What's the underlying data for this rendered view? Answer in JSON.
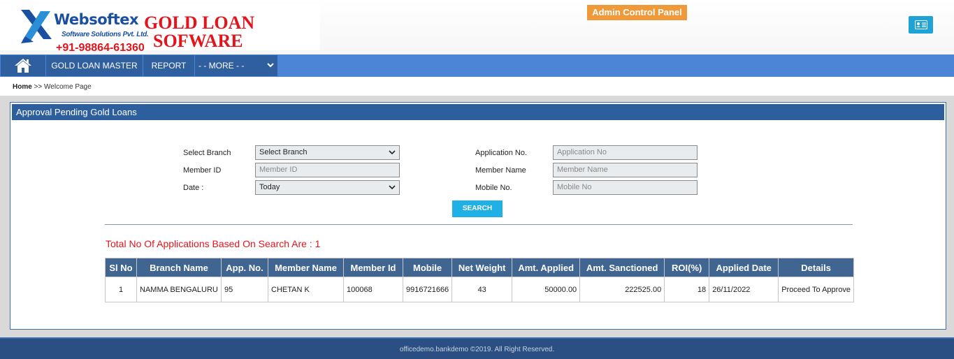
{
  "brand": {
    "name": "Websoftex",
    "subtitle": "Software Solutions Pvt. Ltd.",
    "phone": "+91-98864-61360",
    "product_line1": "GOLD LOAN",
    "product_line2": "SOFWARE",
    "logo_color": "#1b4fa0",
    "accent_color": "#e3141c"
  },
  "header": {
    "admin_panel_label": "Admin Control Panel",
    "profile_icon": "id-card-icon"
  },
  "nav": {
    "home_icon": "home-icon",
    "items": [
      "GOLD LOAN MASTER",
      "REPORT"
    ],
    "more_label": "- - MORE - -"
  },
  "breadcrumb": {
    "home": "Home",
    "separator": ">>",
    "current": "Welcome Page"
  },
  "panel": {
    "title": "Approval Pending Gold Loans"
  },
  "form": {
    "branch_label": "Select Branch",
    "branch_value": "Select Branch",
    "member_id_label": "Member ID",
    "member_id_placeholder": "Member ID",
    "date_label": "Date :",
    "date_value": "Today",
    "app_no_label": "Application No.",
    "app_no_placeholder": "Application No",
    "member_name_label": "Member Name",
    "member_name_placeholder": "Member Name",
    "mobile_label": "Mobile No.",
    "mobile_placeholder": "Mobile No",
    "search_label": "SEARCH"
  },
  "results": {
    "summary": "Total No Of Applications Based On Search Are : 1",
    "columns": [
      "Sl No",
      "Branch Name",
      "App. No.",
      "Member Name",
      "Member Id",
      "Mobile",
      "Net Weight",
      "Amt. Applied",
      "Amt. Sanctioned",
      "ROI(%)",
      "Applied Date",
      "Details"
    ],
    "rows": [
      {
        "sl": "1",
        "branch": "NAMMA BENGALURU",
        "app_no": "95",
        "member_name": "CHETAN K",
        "member_id": "100068",
        "mobile": "9916721666",
        "net_weight": "43",
        "amt_applied": "50000.00",
        "amt_sanctioned": "222525.00",
        "roi": "18",
        "applied_date": "26/11/2022",
        "details": "Proceed To Approve"
      }
    ]
  },
  "footer": {
    "text": "officedemo.bankdemo ©2019. All Right Reserved."
  }
}
